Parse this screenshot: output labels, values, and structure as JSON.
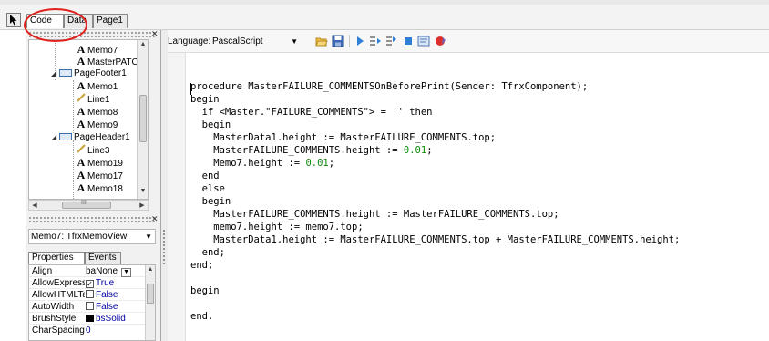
{
  "tabs": {
    "code": "Code",
    "data": "Data",
    "page1": "Page1"
  },
  "tree": {
    "items": [
      {
        "label": "Memo7",
        "icon": "text-object-icon"
      },
      {
        "label": "MasterPATC",
        "icon": "text-object-icon"
      },
      {
        "label": "PageFooter1",
        "icon": "band-icon"
      },
      {
        "label": "Memo1",
        "icon": "text-object-icon"
      },
      {
        "label": "Line1",
        "icon": "line-icon"
      },
      {
        "label": "Memo8",
        "icon": "text-object-icon"
      },
      {
        "label": "Memo9",
        "icon": "text-object-icon"
      },
      {
        "label": "PageHeader1",
        "icon": "band-icon"
      },
      {
        "label": "Line3",
        "icon": "line-icon"
      },
      {
        "label": "Memo19",
        "icon": "text-object-icon"
      },
      {
        "label": "Memo17",
        "icon": "text-object-icon"
      },
      {
        "label": "Memo18",
        "icon": "text-object-icon"
      }
    ],
    "hscroll_thumb_label": "III"
  },
  "object_select": {
    "value": "Memo7: TfrxMemoView"
  },
  "inspector": {
    "tabs": {
      "properties": "Properties",
      "events": "Events"
    },
    "rows": [
      {
        "name": "Align",
        "value": "baNone",
        "kind": "dropdown"
      },
      {
        "name": "AllowExpress",
        "value": "True",
        "kind": "checked"
      },
      {
        "name": "AllowHTMLTa",
        "value": "False",
        "kind": "unchecked"
      },
      {
        "name": "AutoWidth",
        "value": "False",
        "kind": "unchecked"
      },
      {
        "name": "BrushStyle",
        "value": "bsSolid",
        "kind": "swatch"
      },
      {
        "name": "CharSpacing",
        "value": "0",
        "kind": "plain"
      }
    ]
  },
  "toolbar": {
    "language_label": "Language:",
    "language_value": "PascalScript",
    "icons": [
      "open-folder-icon",
      "save-icon",
      "run-icon",
      "step-into-icon",
      "step-over-icon",
      "stop-icon",
      "evaluate-icon",
      "breakpoint-icon"
    ]
  },
  "code": {
    "lines": [
      "",
      "procedure MasterFAILURE_COMMENTSOnBeforePrint(Sender: TfrxComponent);",
      "begin",
      "  if <Master.\"FAILURE_COMMENTS\"> = '' then",
      "  begin",
      "    MasterData1.height := MasterFAILURE_COMMENTS.top;",
      "    MasterFAILURE_COMMENTS.height := |0.01|;",
      "    Memo7.height := |0.01|;",
      "  end",
      "  else",
      "  begin",
      "    MasterFAILURE_COMMENTS.height := MasterFAILURE_COMMENTS.top;",
      "    memo7.height := memo7.top;",
      "    MasterData1.height := MasterFAILURE_COMMENTS.top + MasterFAILURE_COMMENTS.height;",
      "  end;",
      "end;",
      "",
      "begin",
      "",
      "end."
    ]
  },
  "colors": {
    "annotation": "#e0201c",
    "number_literal": "#0b8a0b",
    "property_value": "#0000a0"
  }
}
